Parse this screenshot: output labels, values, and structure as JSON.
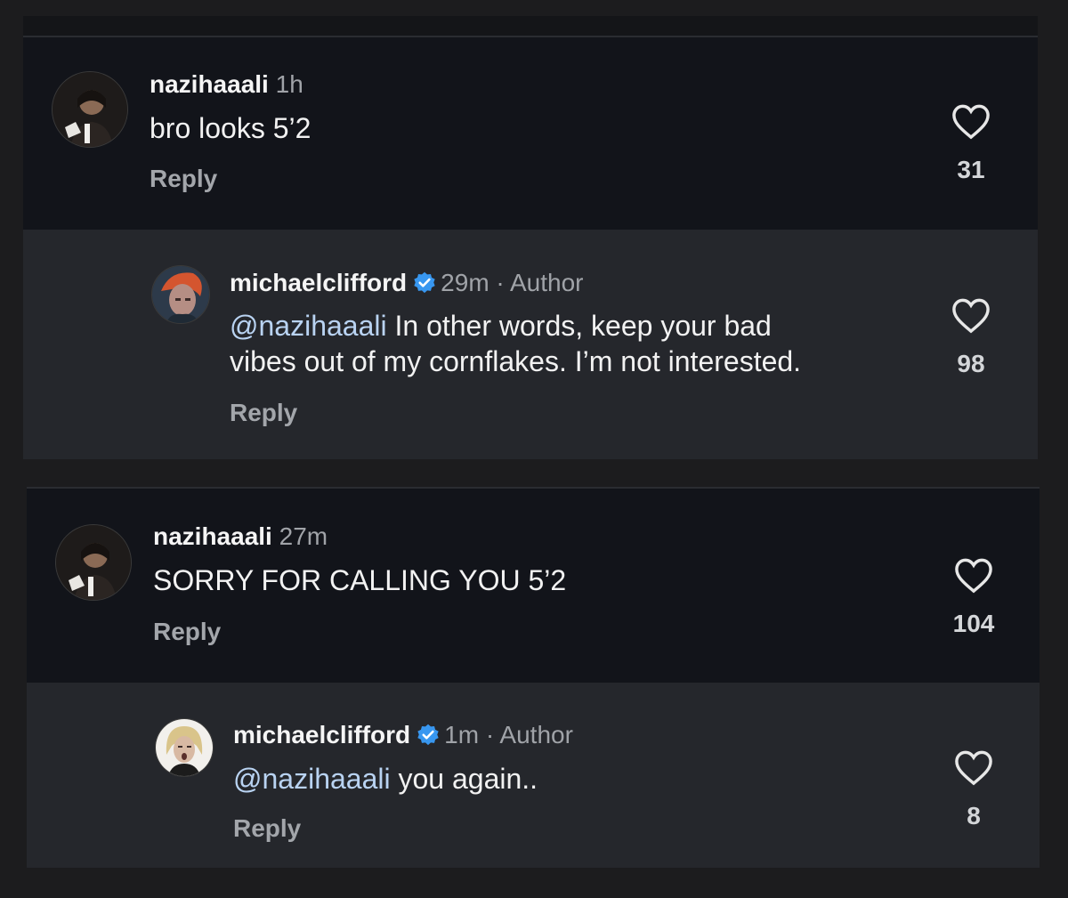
{
  "comments": [
    {
      "username": "nazihaaali",
      "time": "1h",
      "text": "bro looks 5’2",
      "reply_label": "Reply",
      "likes": "31"
    },
    {
      "username": "michaelclifford",
      "time": "29m",
      "separator": "·",
      "author_tag": "Author",
      "mention": "@nazihaaali",
      "text_line1": " In other words, keep your bad",
      "text_line2": "vibes out of my cornflakes. I’m not interested.",
      "reply_label": "Reply",
      "likes": "98"
    },
    {
      "username": "nazihaaali",
      "time": "27m",
      "text": "SORRY FOR CALLING YOU 5’2",
      "reply_label": "Reply",
      "likes": "104"
    },
    {
      "username": "michaelclifford",
      "time": "1m",
      "separator": "·",
      "author_tag": "Author",
      "mention": "@nazihaaali",
      "text": " you again..",
      "reply_label": "Reply",
      "likes": "8"
    }
  ],
  "colors": {
    "background": "#1c1c1e",
    "main_comment_bg": "#12141a",
    "reply_bg": "#25272c",
    "mention": "#b9d3f2",
    "verified": "#3897f0",
    "muted_text": "#a0a3a8"
  },
  "icons": {
    "like": "heart-outline-icon",
    "verified": "verified-badge-icon"
  }
}
